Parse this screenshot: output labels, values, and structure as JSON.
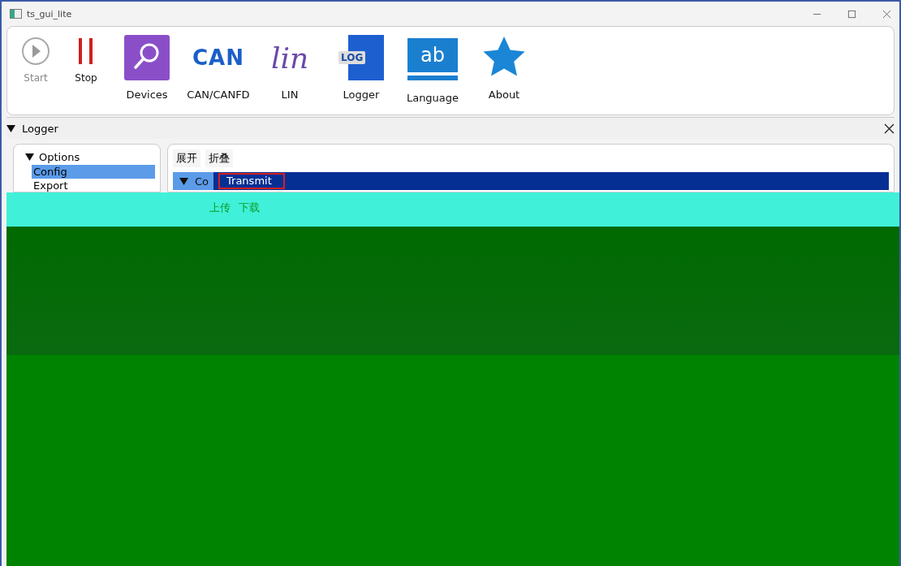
{
  "window": {
    "title": "ts_gui_lite"
  },
  "toolbar": [
    {
      "kind": "start",
      "label": "Start",
      "disabled": true
    },
    {
      "kind": "stop",
      "label": "Stop",
      "disabled": false
    },
    {
      "kind": "devices",
      "label": "Devices",
      "disabled": false
    },
    {
      "kind": "can",
      "label": "CAN/CANFD",
      "icon_text": "CAN",
      "disabled": false
    },
    {
      "kind": "lin",
      "label": "LIN",
      "icon_text": "lin",
      "disabled": false
    },
    {
      "kind": "logger",
      "label": "Logger",
      "icon_text": "LOG",
      "disabled": false
    },
    {
      "kind": "language",
      "label": "Language",
      "icon_text": "ab",
      "disabled": false
    },
    {
      "kind": "about",
      "label": "About",
      "disabled": false
    }
  ],
  "panel": {
    "title": "Logger",
    "expanded": true
  },
  "tree": [
    {
      "label": "Options",
      "expanded": true,
      "children": [
        {
          "label": "Config",
          "selected": true
        },
        {
          "label": "Export",
          "selected": false
        }
      ]
    }
  ],
  "actions": [
    "展开",
    "折叠"
  ],
  "section": {
    "title": "Co",
    "field_value": "Transmit",
    "expanded": true
  },
  "section_actions": [
    "上传",
    "下载"
  ]
}
